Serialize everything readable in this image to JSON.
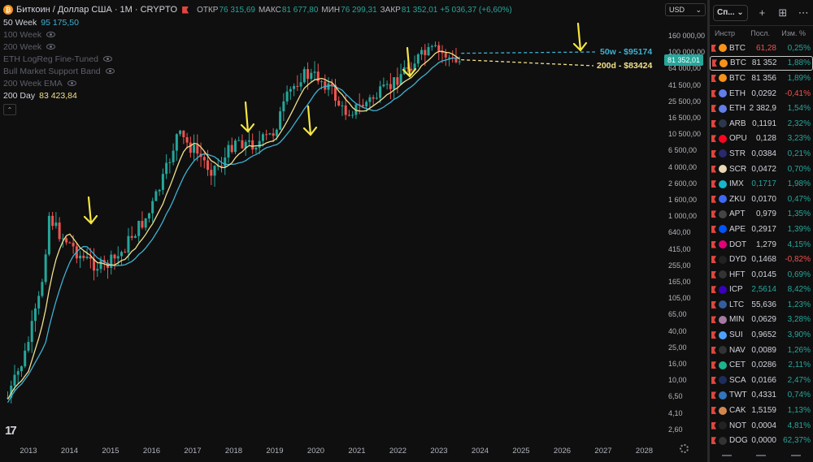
{
  "header": {
    "symbol_title": "Биткоин / Доллар США · 1M · CRYPTO",
    "ohlc": [
      {
        "key": "ОТКР",
        "value": "76 315,69"
      },
      {
        "key": "МАКС",
        "value": "81 677,80"
      },
      {
        "key": "МИН",
        "value": "76 299,31"
      },
      {
        "key": "ЗАКР",
        "value": "81 352,01"
      }
    ],
    "change": "+5 036,37 (+6,60%)"
  },
  "indicators": [
    {
      "name": "50 Week",
      "value": "95 175,50",
      "style": "blue"
    },
    {
      "name": "100 Week",
      "value": "",
      "style": "dim"
    },
    {
      "name": "200 Week",
      "value": "",
      "style": "dim"
    },
    {
      "name": "ETH LogReg Fine-Tuned",
      "value": "",
      "style": "dim"
    },
    {
      "name": "Bull Market Support Band",
      "value": "",
      "style": "dim"
    },
    {
      "name": "200 Week EMA",
      "value": "",
      "style": "dim"
    },
    {
      "name": "200 Day",
      "value": "83 423,84",
      "style": "yellow"
    }
  ],
  "annotations": {
    "ma50w": "50w - $95174",
    "ma200d": "200d - $83424"
  },
  "colors": {
    "up": "#26a69a",
    "down": "#ef5350",
    "ma50w": "#3fb1d2",
    "ma200d": "#f2e08c",
    "arrow": "#f5e642"
  },
  "price_axis": {
    "currency": "USD",
    "current_price": "81 352,01",
    "ticks": [
      "160 000,00",
      "100 000,00",
      "64 000,00",
      "41 500,00",
      "25 500,00",
      "16 500,00",
      "10 500,00",
      "6 500,00",
      "4 000,00",
      "2 600,00",
      "1 600,00",
      "1 000,00",
      "640,00",
      "415,00",
      "255,00",
      "165,00",
      "105,00",
      "65,00",
      "40,00",
      "25,00",
      "16,00",
      "10,00",
      "6,50",
      "4,10",
      "2,60"
    ]
  },
  "time_axis": {
    "labels": [
      "2013",
      "2014",
      "2015",
      "2016",
      "2017",
      "2018",
      "2019",
      "2020",
      "2021",
      "2022",
      "2023",
      "2024",
      "2025",
      "2026",
      "2027",
      "2028"
    ]
  },
  "watchlist": {
    "selector_label": "Сп...",
    "columns": {
      "symbol": "Инстр",
      "last": "Посл.",
      "change": "Изм. %"
    },
    "rows": [
      {
        "sym": "BTC",
        "last": "61,28",
        "change": "0,25%",
        "dir": "pos",
        "last_color": "neg",
        "icon": "bitcoin-icon",
        "color": "#f7931a"
      },
      {
        "sym": "BTC",
        "last": "81 352",
        "change": "1,88%",
        "dir": "pos",
        "last_color": "neu",
        "icon": "bitcoin-icon",
        "color": "#f7931a",
        "active": true
      },
      {
        "sym": "BTC",
        "last": "81 356",
        "change": "1,89%",
        "dir": "pos",
        "last_color": "neu",
        "icon": "bitcoin-icon",
        "color": "#f7931a"
      },
      {
        "sym": "ETH",
        "last": "0,0292",
        "change": "-0,41%",
        "dir": "neg",
        "last_color": "neu",
        "icon": "ethereum-icon",
        "color": "#627eea"
      },
      {
        "sym": "ETH",
        "last": "2 382,9",
        "change": "1,54%",
        "dir": "pos",
        "last_color": "neu",
        "icon": "ethereum-icon",
        "color": "#627eea"
      },
      {
        "sym": "ARB",
        "last": "0,1191",
        "change": "2,32%",
        "dir": "pos",
        "last_color": "neu",
        "icon": "arbitrum-icon",
        "color": "#2d374b"
      },
      {
        "sym": "OPU",
        "last": "0,128",
        "change": "3,23%",
        "dir": "pos",
        "last_color": "neu",
        "icon": "optimism-icon",
        "color": "#ff0420"
      },
      {
        "sym": "STR",
        "last": "0,0384",
        "change": "0,21%",
        "dir": "pos",
        "last_color": "neu",
        "icon": "starknet-icon",
        "color": "#29296e"
      },
      {
        "sym": "SCR",
        "last": "0,0472",
        "change": "0,70%",
        "dir": "pos",
        "last_color": "neu",
        "icon": "scroll-icon",
        "color": "#e8d8b4"
      },
      {
        "sym": "IMX",
        "last": "0,1717",
        "change": "1,98%",
        "dir": "pos",
        "last_color": "pos",
        "icon": "immutable-icon",
        "color": "#17b5cb"
      },
      {
        "sym": "ZKU",
        "last": "0,0170",
        "change": "0,47%",
        "dir": "pos",
        "last_color": "neu",
        "icon": "zksync-icon",
        "color": "#3e69f5"
      },
      {
        "sym": "APT",
        "last": "0,979",
        "change": "1,35%",
        "dir": "pos",
        "last_color": "neu",
        "icon": "aptos-icon",
        "color": "#444"
      },
      {
        "sym": "APE",
        "last": "0,2917",
        "change": "1,39%",
        "dir": "pos",
        "last_color": "neu",
        "icon": "ape-icon",
        "color": "#0054f9"
      },
      {
        "sym": "DOT",
        "last": "1,279",
        "change": "4,15%",
        "dir": "pos",
        "last_color": "neu",
        "icon": "polkadot-icon",
        "color": "#e6007a"
      },
      {
        "sym": "DYD",
        "last": "0,1468",
        "change": "-0,82%",
        "dir": "neg",
        "last_color": "neu",
        "icon": "dydx-icon",
        "color": "#222"
      },
      {
        "sym": "HFT",
        "last": "0,0145",
        "change": "0,69%",
        "dir": "pos",
        "last_color": "neu",
        "icon": "hashflow-icon",
        "color": "#333"
      },
      {
        "sym": "ICP",
        "last": "2,5614",
        "change": "8,42%",
        "dir": "pos",
        "last_color": "pos",
        "icon": "icp-icon",
        "color": "#3b00b9"
      },
      {
        "sym": "LTC",
        "last": "55,636",
        "change": "1,23%",
        "dir": "pos",
        "last_color": "neu",
        "icon": "litecoin-icon",
        "color": "#345d9d"
      },
      {
        "sym": "MIN",
        "last": "0,0629",
        "change": "3,28%",
        "dir": "pos",
        "last_color": "neu",
        "icon": "mina-icon",
        "color": "#a77aa0"
      },
      {
        "sym": "SUI",
        "last": "0,9652",
        "change": "3,90%",
        "dir": "pos",
        "last_color": "neu",
        "icon": "sui-icon",
        "color": "#4da2ff"
      },
      {
        "sym": "NAV",
        "last": "0,0089",
        "change": "1,26%",
        "dir": "pos",
        "last_color": "neu",
        "icon": "nav-icon",
        "color": "#333"
      },
      {
        "sym": "CET",
        "last": "0,0286",
        "change": "2,11%",
        "dir": "pos",
        "last_color": "neu",
        "icon": "coinex-icon",
        "color": "#1db38c"
      },
      {
        "sym": "SCA",
        "last": "0,0166",
        "change": "2,47%",
        "dir": "pos",
        "last_color": "neu",
        "icon": "scallop-icon",
        "color": "#1f2d5c"
      },
      {
        "sym": "TWT",
        "last": "0,4331",
        "change": "0,74%",
        "dir": "pos",
        "last_color": "neu",
        "icon": "trustwallet-icon",
        "color": "#3375bb"
      },
      {
        "sym": "CAK",
        "last": "1,5159",
        "change": "1,13%",
        "dir": "pos",
        "last_color": "neu",
        "icon": "pancake-icon",
        "color": "#d1884f"
      },
      {
        "sym": "NOT",
        "last": "0,0004",
        "change": "4,81%",
        "dir": "pos",
        "last_color": "neu",
        "icon": "notcoin-icon",
        "color": "#222"
      },
      {
        "sym": "DOG",
        "last": "0,0000",
        "change": "62,37%",
        "dir": "pos",
        "last_color": "neu",
        "icon": "dog-icon",
        "color": "#333"
      }
    ]
  }
}
